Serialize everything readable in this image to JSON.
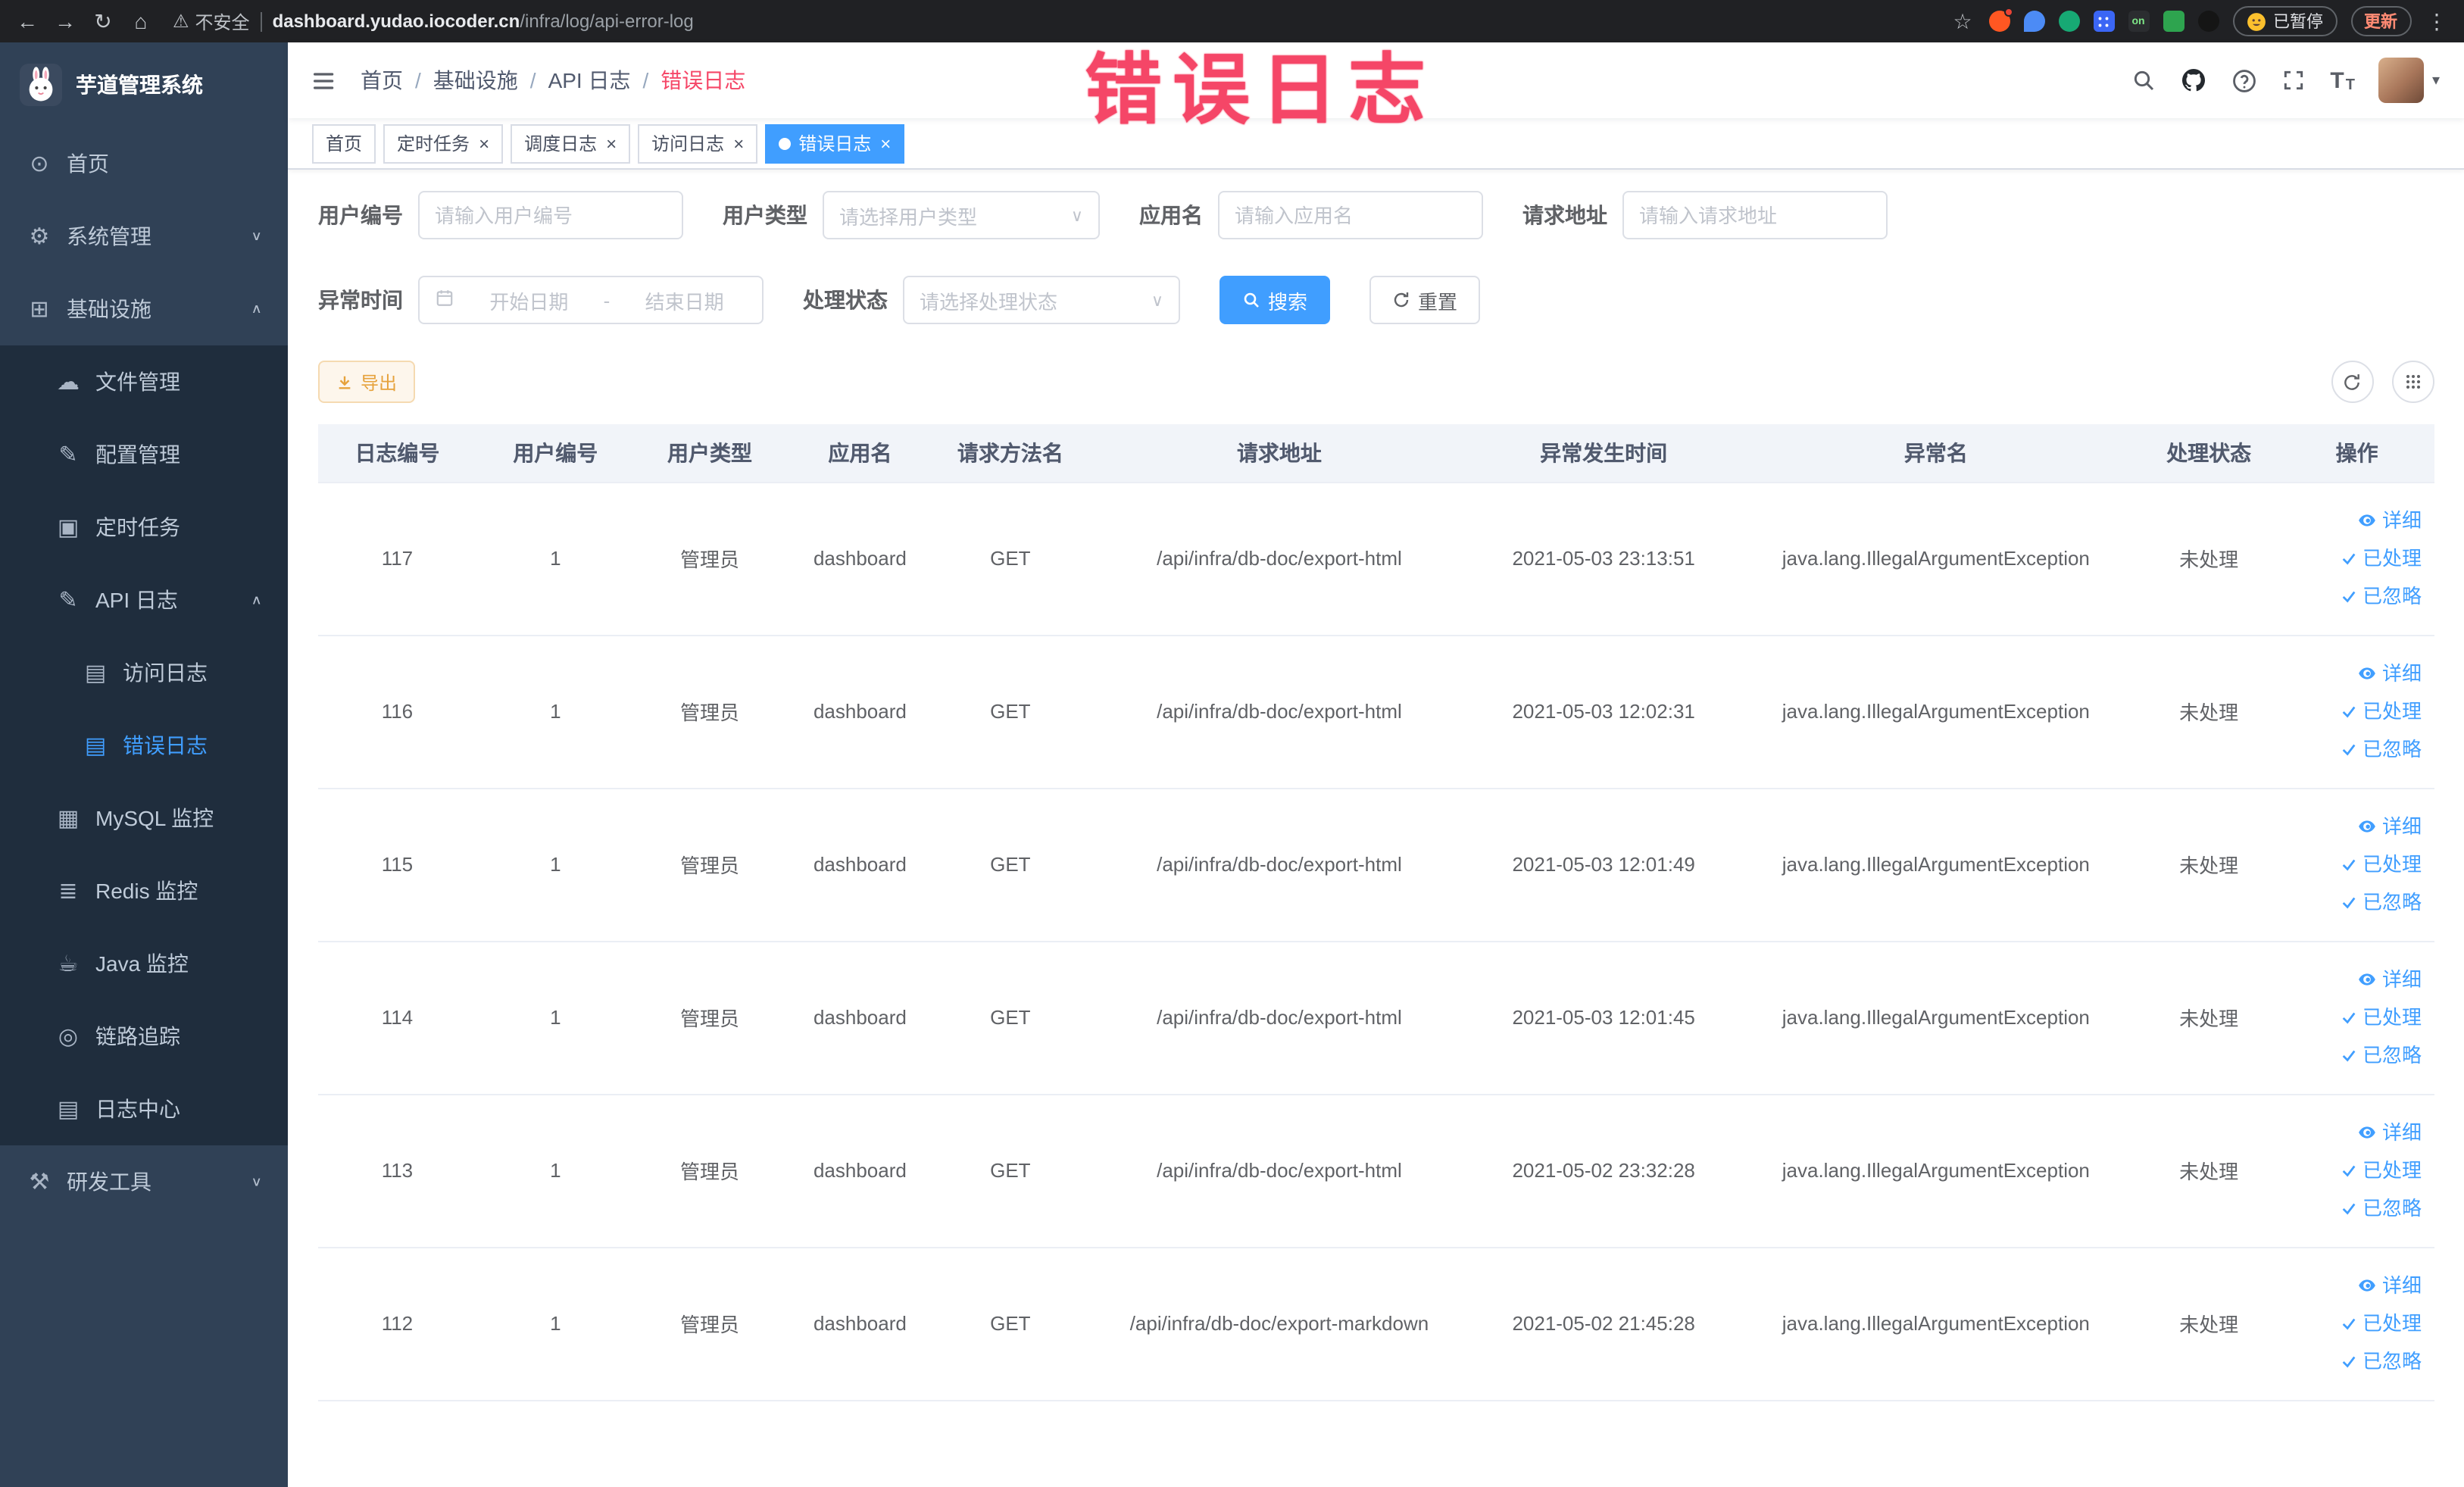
{
  "annotation": {
    "text": "错误日志"
  },
  "browser": {
    "security_label": "不安全",
    "url_host": "dashboard.yudao.iocoder.cn",
    "url_path": "/infra/log/api-error-log",
    "paused_label": "已暂停",
    "update_label": "更新",
    "extension_on_label": "on"
  },
  "icon_glyphs": {
    "back-icon": "←",
    "forward-icon": "→",
    "reload-icon": "↻",
    "home-icon": "⌂",
    "warning-icon": "⚠",
    "star-icon": "☆",
    "kebab-icon": "⋮",
    "close-icon": "×",
    "chevron-down-icon": "∨",
    "chevron-up-icon": "∧",
    "caret-down-icon": "▾",
    "font-size-icon": "T",
    "dashboard-icon": "⊙",
    "gear-icon": "⚙",
    "grid-icon": "⊞",
    "file-icon": "☁",
    "config-icon": "✎",
    "timer-icon": "▣",
    "log-icon": "✎",
    "doc-icon": "▤",
    "mysql-icon": "▦",
    "redis-icon": "≣",
    "java-icon": "☕",
    "trace-icon": "◎",
    "log-center-icon": "▤",
    "tools-icon": "⚒"
  },
  "sidebar": {
    "logo_title": "芋道管理系统",
    "items": [
      {
        "key": "home",
        "label": "首页",
        "icon": "dashboard-icon",
        "level": 1
      },
      {
        "key": "system",
        "label": "系统管理",
        "icon": "gear-icon",
        "level": 1,
        "arrow": "down"
      },
      {
        "key": "infra",
        "label": "基础设施",
        "icon": "grid-icon",
        "level": 1,
        "arrow": "up",
        "expanded": true
      },
      {
        "key": "file",
        "label": "文件管理",
        "icon": "file-icon",
        "level": 2
      },
      {
        "key": "config",
        "label": "配置管理",
        "icon": "config-icon",
        "level": 2
      },
      {
        "key": "job",
        "label": "定时任务",
        "icon": "timer-icon",
        "level": 2
      },
      {
        "key": "api-log",
        "label": "API 日志",
        "icon": "log-icon",
        "level": 2,
        "arrow": "up",
        "expanded": true
      },
      {
        "key": "access-log",
        "label": "访问日志",
        "icon": "doc-icon",
        "level": 3
      },
      {
        "key": "error-log",
        "label": "错误日志",
        "icon": "doc-icon",
        "level": 3,
        "active": true
      },
      {
        "key": "mysql",
        "label": "MySQL 监控",
        "icon": "mysql-icon",
        "level": 2
      },
      {
        "key": "redis",
        "label": "Redis 监控",
        "icon": "redis-icon",
        "level": 2
      },
      {
        "key": "java",
        "label": "Java 监控",
        "icon": "java-icon",
        "level": 2
      },
      {
        "key": "trace",
        "label": "链路追踪",
        "icon": "trace-icon",
        "level": 2
      },
      {
        "key": "log-center",
        "label": "日志中心",
        "icon": "log-center-icon",
        "level": 2
      },
      {
        "key": "dev-tools",
        "label": "研发工具",
        "icon": "tools-icon",
        "level": 1,
        "arrow": "down"
      }
    ]
  },
  "topbar": {
    "separator": "/",
    "breadcrumb": [
      {
        "label": "首页"
      },
      {
        "label": "基础设施"
      },
      {
        "label": "API 日志"
      },
      {
        "label": "错误日志",
        "current": true
      }
    ]
  },
  "tabs": [
    {
      "key": "home",
      "label": "首页",
      "closable": false,
      "active": false
    },
    {
      "key": "job",
      "label": "定时任务",
      "closable": true,
      "active": false
    },
    {
      "key": "job-log",
      "label": "调度日志",
      "closable": true,
      "active": false
    },
    {
      "key": "access-log",
      "label": "访问日志",
      "closable": true,
      "active": false
    },
    {
      "key": "error-log",
      "label": "错误日志",
      "closable": true,
      "active": true
    }
  ],
  "filters": {
    "rows": [
      [
        {
          "name": "user-id",
          "label": "用户编号",
          "type": "input",
          "placeholder": "请输入用户编号"
        },
        {
          "name": "user-type",
          "label": "用户类型",
          "type": "select",
          "placeholder": "请选择用户类型"
        },
        {
          "name": "app-name",
          "label": "应用名",
          "type": "input",
          "placeholder": "请输入应用名"
        },
        {
          "name": "request-url",
          "label": "请求地址",
          "type": "input",
          "placeholder": "请输入请求地址"
        }
      ],
      [
        {
          "name": "exception-time",
          "label": "异常时间",
          "type": "daterange",
          "start_placeholder": "开始日期",
          "end_placeholder": "结束日期",
          "separator": "-"
        },
        {
          "name": "process-status",
          "label": "处理状态",
          "type": "select",
          "placeholder": "请选择处理状态"
        }
      ]
    ],
    "search_label": "搜索",
    "reset_label": "重置"
  },
  "toolbar": {
    "export_label": "导出"
  },
  "table": {
    "columns": [
      {
        "key": "id",
        "label": "日志编号"
      },
      {
        "key": "userId",
        "label": "用户编号"
      },
      {
        "key": "userType",
        "label": "用户类型"
      },
      {
        "key": "app",
        "label": "应用名"
      },
      {
        "key": "method",
        "label": "请求方法名"
      },
      {
        "key": "url",
        "label": "请求地址"
      },
      {
        "key": "time",
        "label": "异常发生时间"
      },
      {
        "key": "exception",
        "label": "异常名"
      },
      {
        "key": "status",
        "label": "处理状态"
      },
      {
        "key": "actions",
        "label": "操作"
      }
    ],
    "row_actions": [
      {
        "name": "detail",
        "label": "详细",
        "icon": "eye-icon"
      },
      {
        "name": "processed",
        "label": "已处理",
        "icon": "check-icon"
      },
      {
        "name": "ignored",
        "label": "已忽略",
        "icon": "check-icon"
      }
    ],
    "rows": [
      {
        "id": "117",
        "userId": "1",
        "userType": "管理员",
        "app": "dashboard",
        "method": "GET",
        "url": "/api/infra/db-doc/export-html",
        "time": "2021-05-03 23:13:51",
        "exception": "java.lang.IllegalArgumentException",
        "status": "未处理"
      },
      {
        "id": "116",
        "userId": "1",
        "userType": "管理员",
        "app": "dashboard",
        "method": "GET",
        "url": "/api/infra/db-doc/export-html",
        "time": "2021-05-03 12:02:31",
        "exception": "java.lang.IllegalArgumentException",
        "status": "未处理"
      },
      {
        "id": "115",
        "userId": "1",
        "userType": "管理员",
        "app": "dashboard",
        "method": "GET",
        "url": "/api/infra/db-doc/export-html",
        "time": "2021-05-03 12:01:49",
        "exception": "java.lang.IllegalArgumentException",
        "status": "未处理"
      },
      {
        "id": "114",
        "userId": "1",
        "userType": "管理员",
        "app": "dashboard",
        "method": "GET",
        "url": "/api/infra/db-doc/export-html",
        "time": "2021-05-03 12:01:45",
        "exception": "java.lang.IllegalArgumentException",
        "status": "未处理"
      },
      {
        "id": "113",
        "userId": "1",
        "userType": "管理员",
        "app": "dashboard",
        "method": "GET",
        "url": "/api/infra/db-doc/export-html",
        "time": "2021-05-02 23:32:28",
        "exception": "java.lang.IllegalArgumentException",
        "status": "未处理"
      },
      {
        "id": "112",
        "userId": "1",
        "userType": "管理员",
        "app": "dashboard",
        "method": "GET",
        "url": "/api/infra/db-doc/export-markdown",
        "time": "2021-05-02 21:45:28",
        "exception": "java.lang.IllegalArgumentException",
        "status": "未处理"
      }
    ]
  }
}
